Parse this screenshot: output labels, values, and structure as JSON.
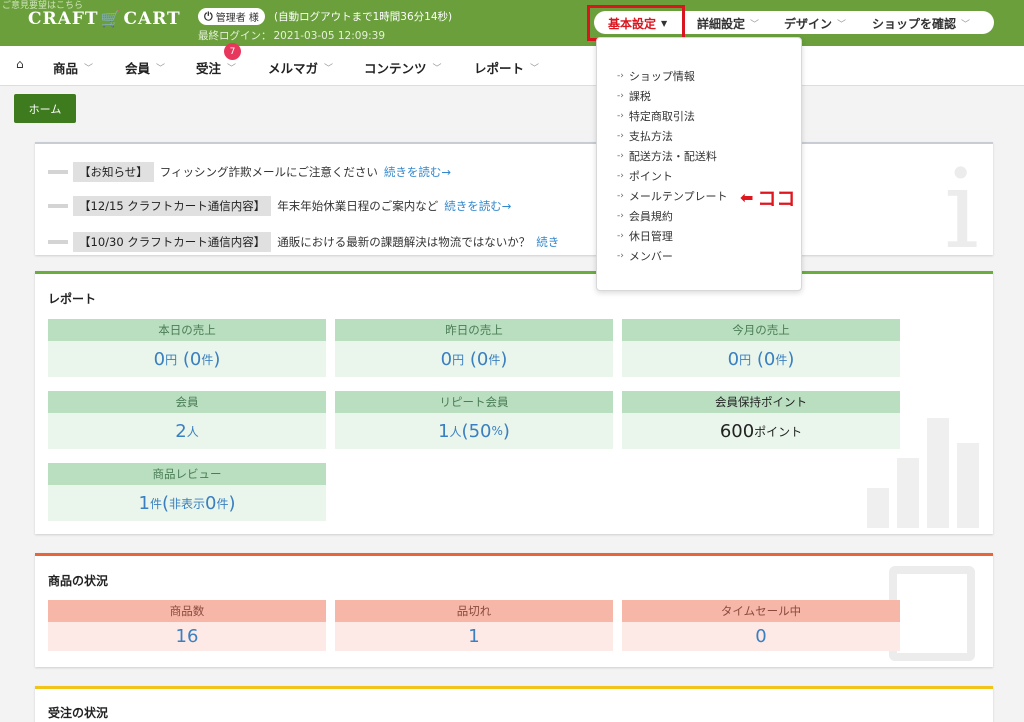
{
  "header": {
    "logo_caption": "ご意見要望はこちら",
    "logo_text_left": "CRAFT",
    "logo_text_right": "CART",
    "admin_label": "管理者 様",
    "auto_logout": "(自動ログアウトまで1時間36分14秒)",
    "last_login_label": "最終ログイン：",
    "last_login_value": "2021-03-05 12:09:39",
    "nav": [
      {
        "label": "基本設定"
      },
      {
        "label": "詳細設定"
      },
      {
        "label": "デザイン"
      },
      {
        "label": "ショップを確認"
      }
    ]
  },
  "subnav": {
    "items": [
      {
        "label": "商品"
      },
      {
        "label": "会員"
      },
      {
        "label": "受注"
      },
      {
        "label": "メルマガ"
      },
      {
        "label": "コンテンツ"
      },
      {
        "label": "レポート"
      }
    ],
    "order_badge": "7"
  },
  "breadcrumb": "ホーム",
  "notices": [
    {
      "tag": "【お知らせ】",
      "text": "フィッシング詐欺メールにご注意ください",
      "link": "続きを読む→"
    },
    {
      "tag": "【12/15 クラフトカート通信内容】",
      "text": "年末年始休業日程のご案内など",
      "link": "続きを読む→"
    },
    {
      "tag": "【10/30 クラフトカート通信内容】",
      "text": "通販における最新の課題解決は物流ではないか？",
      "link": "続き"
    }
  ],
  "report": {
    "title": "レポート",
    "cards": [
      {
        "label": "本日の売上",
        "value": "0",
        "unit": "円",
        "sub": "(0",
        "sub_unit": "件",
        "close": ")"
      },
      {
        "label": "昨日の売上",
        "value": "0",
        "unit": "円",
        "sub": "(0",
        "sub_unit": "件",
        "close": ")"
      },
      {
        "label": "今月の売上",
        "value": "0",
        "unit": "円",
        "sub": "(0",
        "sub_unit": "件",
        "close": ")"
      },
      {
        "label": "会員",
        "value": "2",
        "unit": "人"
      },
      {
        "label": "リピート会員",
        "value": "1",
        "unit": "人",
        "sub": "(50",
        "sub_unit": "%",
        "close": ")"
      },
      {
        "label": "会員保持ポイント",
        "value": "600",
        "unit": "ポイント"
      },
      {
        "label": "商品レビュー",
        "value": "1",
        "unit": "件",
        "sub": "(",
        "sub_unit": "非表示",
        "sub2": "0",
        "sub2_unit": "件",
        "close": ")"
      }
    ]
  },
  "product_status": {
    "title": "商品の状況",
    "cards": [
      {
        "label": "商品数",
        "value": "16"
      },
      {
        "label": "品切れ",
        "value": "1"
      },
      {
        "label": "タイムセール中",
        "value": "0"
      }
    ]
  },
  "order_status": {
    "title": "受注の状況"
  },
  "dropdown": {
    "items": [
      {
        "label": "ショップ情報"
      },
      {
        "label": "課税"
      },
      {
        "label": "特定商取引法"
      },
      {
        "label": "支払方法"
      },
      {
        "label": "配送方法・配送料"
      },
      {
        "label": "ポイント"
      },
      {
        "label": "メールテンプレート"
      },
      {
        "label": "会員規約"
      },
      {
        "label": "休日管理"
      },
      {
        "label": "メンバー"
      }
    ]
  },
  "annotation": "ココ",
  "colors": {
    "header_green": "#6a9f3c",
    "highlight_red": "#d9161f",
    "link_blue": "#3388cc",
    "report_accent": "#6aad3e",
    "status_accent": "#e8653a",
    "orders_accent": "#f0c419"
  },
  "icons": {
    "power": "power-icon",
    "home": "home-icon",
    "annotation_arrow": "left-arrow-icon"
  }
}
